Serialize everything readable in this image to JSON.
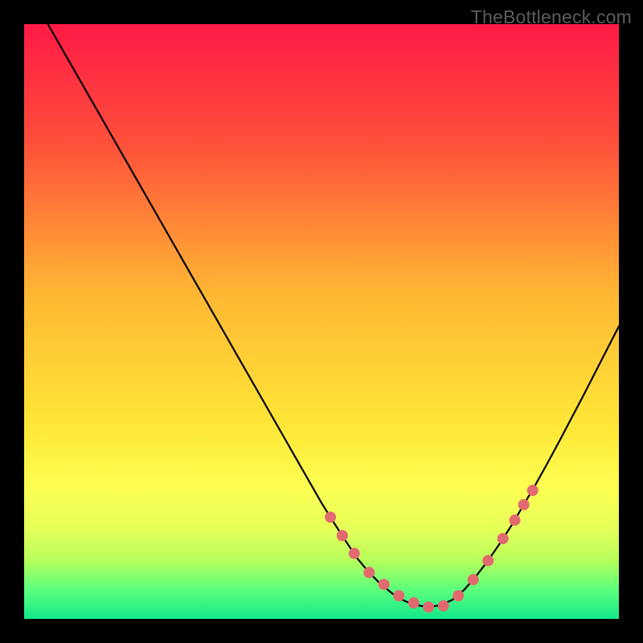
{
  "watermark": "TheBottleneck.com",
  "chart_data": {
    "type": "line",
    "title": "",
    "xlabel": "",
    "ylabel": "",
    "xlim": [
      0,
      100
    ],
    "ylim": [
      0,
      100
    ],
    "gradient_stops": [
      {
        "offset": 0,
        "color": "#ff1a47"
      },
      {
        "offset": 20,
        "color": "#ff4f3a"
      },
      {
        "offset": 45,
        "color": "#ffb634"
      },
      {
        "offset": 68,
        "color": "#ffe837"
      },
      {
        "offset": 78,
        "color": "#fdff52"
      },
      {
        "offset": 85,
        "color": "#e5ff59"
      },
      {
        "offset": 90,
        "color": "#b9ff5a"
      },
      {
        "offset": 95,
        "color": "#5dff7c"
      },
      {
        "offset": 100,
        "color": "#12e88b"
      }
    ],
    "series": [
      {
        "name": "bottleneck-curve",
        "color": "#000000",
        "x": [
          4,
          6,
          8,
          10,
          12,
          14,
          16,
          18,
          20,
          22,
          24,
          26,
          28,
          30,
          32,
          34,
          36,
          38,
          40,
          42,
          44,
          46,
          48,
          50,
          52,
          54,
          56,
          58,
          60,
          62,
          64,
          66,
          68,
          70,
          72,
          74,
          76,
          78,
          80,
          82,
          84,
          86,
          88,
          90,
          92,
          94,
          96,
          98,
          100
        ],
        "y": [
          100,
          96.5,
          93,
          89.5,
          86,
          82.5,
          79,
          75.5,
          72,
          68.5,
          65,
          61.5,
          58,
          54.5,
          51,
          47.5,
          44,
          40.5,
          37,
          33.5,
          30,
          26.5,
          23,
          19.5,
          16.3,
          13.2,
          10.2,
          7.8,
          5.8,
          4.2,
          3.0,
          2.3,
          2.0,
          2.3,
          3.2,
          4.9,
          7.2,
          9.8,
          12.7,
          15.8,
          19.2,
          22.6,
          26.2,
          29.9,
          33.7,
          37.5,
          41.4,
          45.3,
          49.2
        ]
      }
    ],
    "markers": {
      "name": "highlight-dots",
      "color": "#e26a6f",
      "radius": 7,
      "x": [
        51.5,
        53.5,
        55.5,
        58,
        60.5,
        63,
        65.5,
        68,
        70.5,
        73,
        75.5,
        78,
        80.5,
        82.5,
        84,
        85.5
      ],
      "y": [
        17.1,
        14.0,
        11.0,
        7.8,
        5.8,
        3.9,
        2.7,
        2.0,
        2.2,
        3.9,
        6.6,
        9.8,
        13.5,
        16.6,
        19.2,
        21.6
      ]
    }
  }
}
